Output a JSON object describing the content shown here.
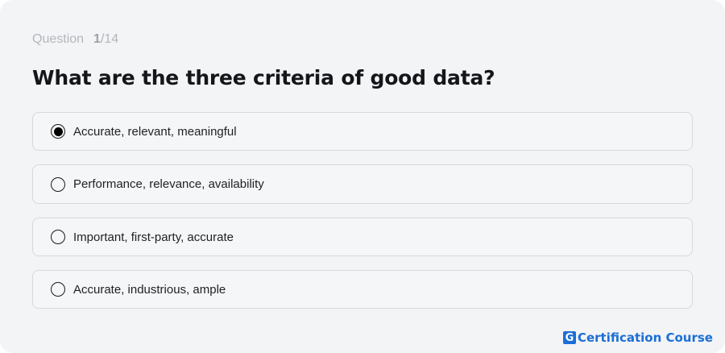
{
  "question": {
    "label": "Question",
    "current": "1",
    "total": "/14",
    "text": "What are the three criteria of good data?"
  },
  "options": [
    {
      "text": "Accurate, relevant, meaningful",
      "selected": true
    },
    {
      "text": "Performance, relevance, availability",
      "selected": false
    },
    {
      "text": "Important, first-party, accurate",
      "selected": false
    },
    {
      "text": "Accurate, industrious, ample",
      "selected": false
    }
  ],
  "brand": {
    "logo_letter": "G",
    "name": "Certification Course",
    "color": "#1a6fd6"
  }
}
